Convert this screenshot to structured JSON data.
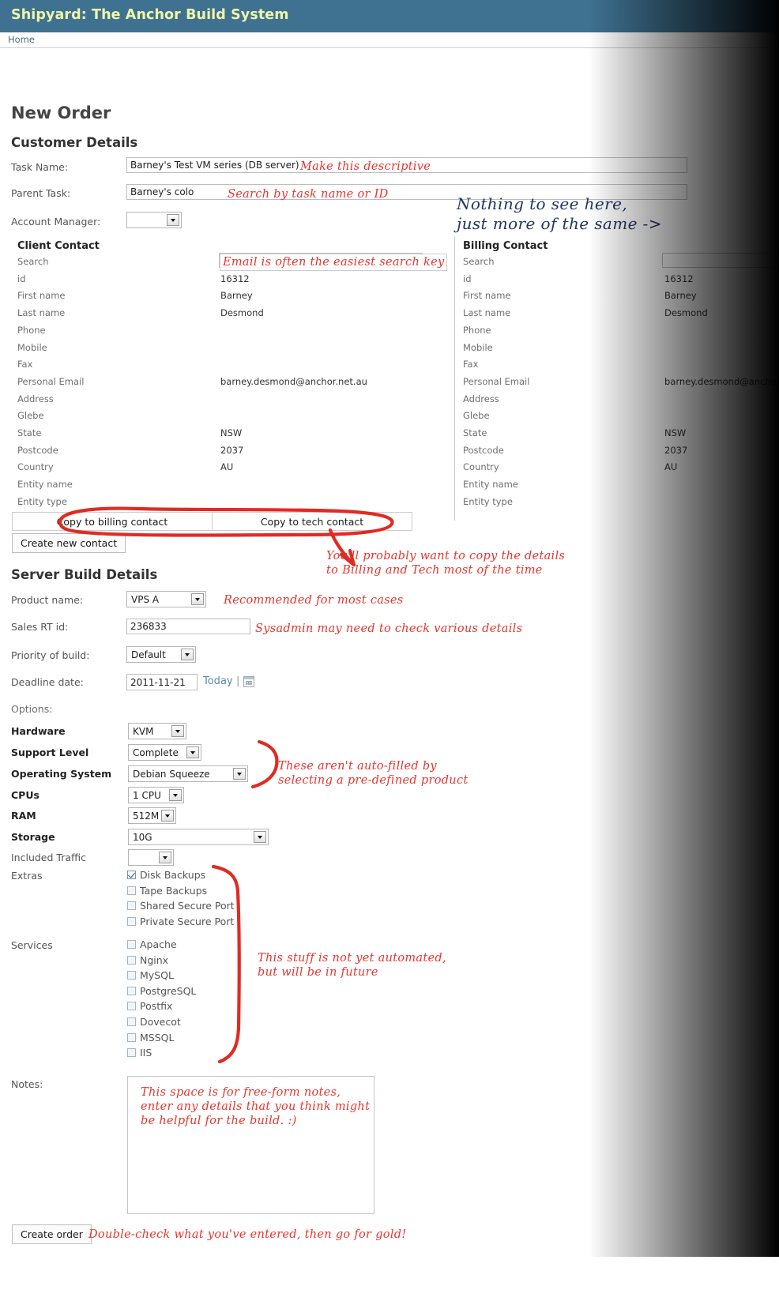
{
  "header": {
    "brand": "Shipyard: The Anchor Build System",
    "breadcrumb": "Home"
  },
  "page": {
    "title": "New Order",
    "customer_section_title": "Customer Details",
    "server_section_title": "Server Build Details"
  },
  "colors": {
    "header_bg": "#3f7291",
    "header_text": "#f2f5a9",
    "annotation_red": "#e8352e",
    "annotation_blue": "#1f3864",
    "link": "#5b86b0"
  },
  "form": {
    "task_name_label": "Task Name:",
    "task_name_value": "Barney's Test VM series (DB server)",
    "parent_task_label": "Parent Task:",
    "parent_task_value": "Barney's colo",
    "account_manager_label": "Account Manager:",
    "account_manager_value": ""
  },
  "client_contact": {
    "heading": "Client Contact",
    "rows": [
      {
        "label": "Search",
        "value": ""
      },
      {
        "label": "id",
        "value": "16312"
      },
      {
        "label": "First name",
        "value": "Barney"
      },
      {
        "label": "Last name",
        "value": "Desmond"
      },
      {
        "label": "Phone",
        "value": ""
      },
      {
        "label": "Mobile",
        "value": ""
      },
      {
        "label": "Fax",
        "value": ""
      },
      {
        "label": "Personal Email",
        "value": "barney.desmond@anchor.net.au"
      },
      {
        "label": "Address",
        "value": ""
      },
      {
        "label": " Glebe",
        "value": ""
      },
      {
        "label": "State",
        "value": "NSW"
      },
      {
        "label": "Postcode",
        "value": "2037"
      },
      {
        "label": "Country",
        "value": "AU"
      },
      {
        "label": "Entity name",
        "value": ""
      },
      {
        "label": "Entity type",
        "value": ""
      }
    ],
    "copy_billing_label": "Copy to billing contact",
    "copy_tech_label": "Copy to tech contact",
    "create_contact_label": "Create new contact"
  },
  "billing_contact": {
    "heading": "Billing Contact",
    "rows": [
      {
        "label": "Search",
        "value": ""
      },
      {
        "label": "id",
        "value": "16312"
      },
      {
        "label": "First name",
        "value": "Barney"
      },
      {
        "label": "Last name",
        "value": "Desmond"
      },
      {
        "label": "Phone",
        "value": ""
      },
      {
        "label": "Mobile",
        "value": ""
      },
      {
        "label": "Fax",
        "value": ""
      },
      {
        "label": "Personal Email",
        "value": "barney.desmond@anchor.net.au"
      },
      {
        "label": "Address",
        "value": ""
      },
      {
        "label": " Glebe",
        "value": ""
      },
      {
        "label": "State",
        "value": "NSW"
      },
      {
        "label": "Postcode",
        "value": "2037"
      },
      {
        "label": "Country",
        "value": "AU"
      },
      {
        "label": "Entity name",
        "value": ""
      },
      {
        "label": "Entity type",
        "value": ""
      }
    ]
  },
  "build": {
    "product_label": "Product name:",
    "product_value": "VPS A",
    "sales_rt_label": "Sales RT id:",
    "sales_rt_value": "236833",
    "priority_label": "Priority of build:",
    "priority_value": "Default",
    "deadline_label": "Deadline date:",
    "deadline_value": "2011-11-21",
    "today_link": "Today",
    "pipe": "|",
    "options_label": "Options:",
    "hardware_label": "Hardware",
    "hardware_value": "KVM",
    "support_label": "Support Level",
    "support_value": "Complete",
    "os_label": "Operating System",
    "os_value": "Debian Squeeze",
    "cpus_label": "CPUs",
    "cpus_value": "1 CPU",
    "ram_label": "RAM",
    "ram_value": "512M",
    "storage_label": "Storage",
    "storage_value": "10G",
    "traffic_label": "Included Traffic",
    "traffic_value": "",
    "extras_label": "Extras",
    "extras": [
      {
        "label": "Disk Backups",
        "checked": true
      },
      {
        "label": "Tape Backups",
        "checked": false
      },
      {
        "label": "Shared Secure Port",
        "checked": false
      },
      {
        "label": "Private Secure Port",
        "checked": false
      }
    ],
    "services_label": "Services",
    "services": [
      {
        "label": "Apache",
        "checked": false
      },
      {
        "label": "Nginx",
        "checked": false
      },
      {
        "label": "MySQL",
        "checked": false
      },
      {
        "label": "PostgreSQL",
        "checked": false
      },
      {
        "label": "Postfix",
        "checked": false
      },
      {
        "label": "Dovecot",
        "checked": false
      },
      {
        "label": "MSSQL",
        "checked": false
      },
      {
        "label": "IIS",
        "checked": false
      }
    ],
    "notes_label": "Notes:",
    "notes_value": "",
    "create_order_label": "Create order"
  },
  "annotations": {
    "task_name": "Make this descriptive",
    "parent_task": "Search by task name or ID",
    "nothing_to_see": "Nothing to see here,\njust more of the same ->",
    "email_search": "Email is often the easiest search key",
    "copy_details": "You'll probably want to copy the details\nto Billing and Tech most of the time",
    "product": "Recommended for most cases",
    "sales_rt": "Sysadmin may need to check various details",
    "not_autofilled": "These aren't auto-filled by\nselecting a pre-defined product",
    "not_automated": "This stuff is not yet automated,\nbut will be in future",
    "notes": "This space is for free-form notes,\nenter any details that you think might\nbe helpful for the build. :)",
    "create_order": "Double-check what you've entered, then go for gold!"
  },
  "icons": {
    "calendar": "calendar-icon",
    "dropdown": "chevron-down-icon"
  }
}
